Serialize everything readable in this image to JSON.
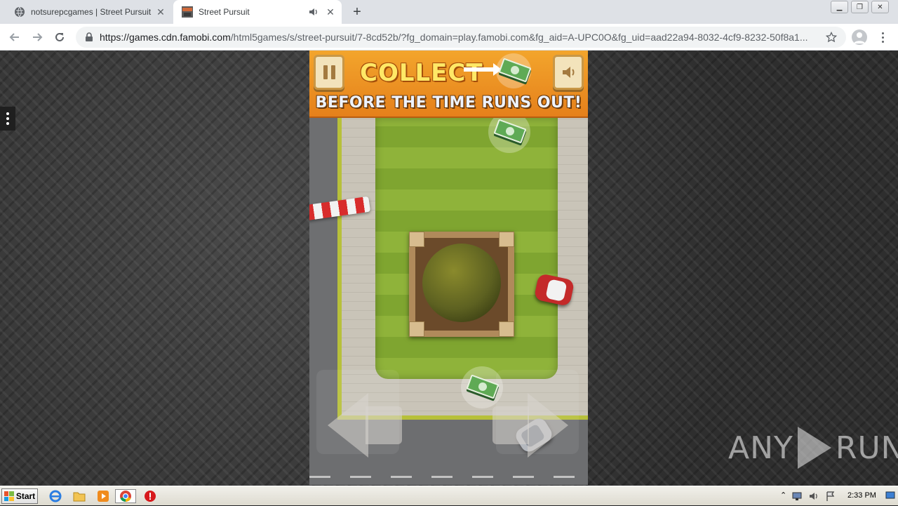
{
  "browser": {
    "tabs": [
      {
        "title": "notsurepcgames | Street Pursuit",
        "active": false,
        "icon": "globe-icon"
      },
      {
        "title": "Street Pursuit",
        "active": true,
        "icon": "street-pursuit-favicon",
        "audio": true
      }
    ],
    "url": {
      "host": "https://games.cdn.famobi.com",
      "path": "/html5games/s/street-pursuit/7-8cd52b/?fg_domain=play.famobi.com&fg_aid=A-UPC0O&fg_uid=aad22a94-8032-4cf9-8232-50f8a1..."
    }
  },
  "game": {
    "banner": {
      "line1": "COLLECT",
      "line2": "BEFORE THE TIME RUNS OUT!"
    },
    "colors": {
      "banner": "#f3a52c",
      "grass": "#8fb33a",
      "road": "#6e6f71"
    }
  },
  "watermark": {
    "left": "ANY",
    "right": "RUN"
  },
  "taskbar": {
    "start_label": "Start",
    "clock": "2:33 PM"
  }
}
